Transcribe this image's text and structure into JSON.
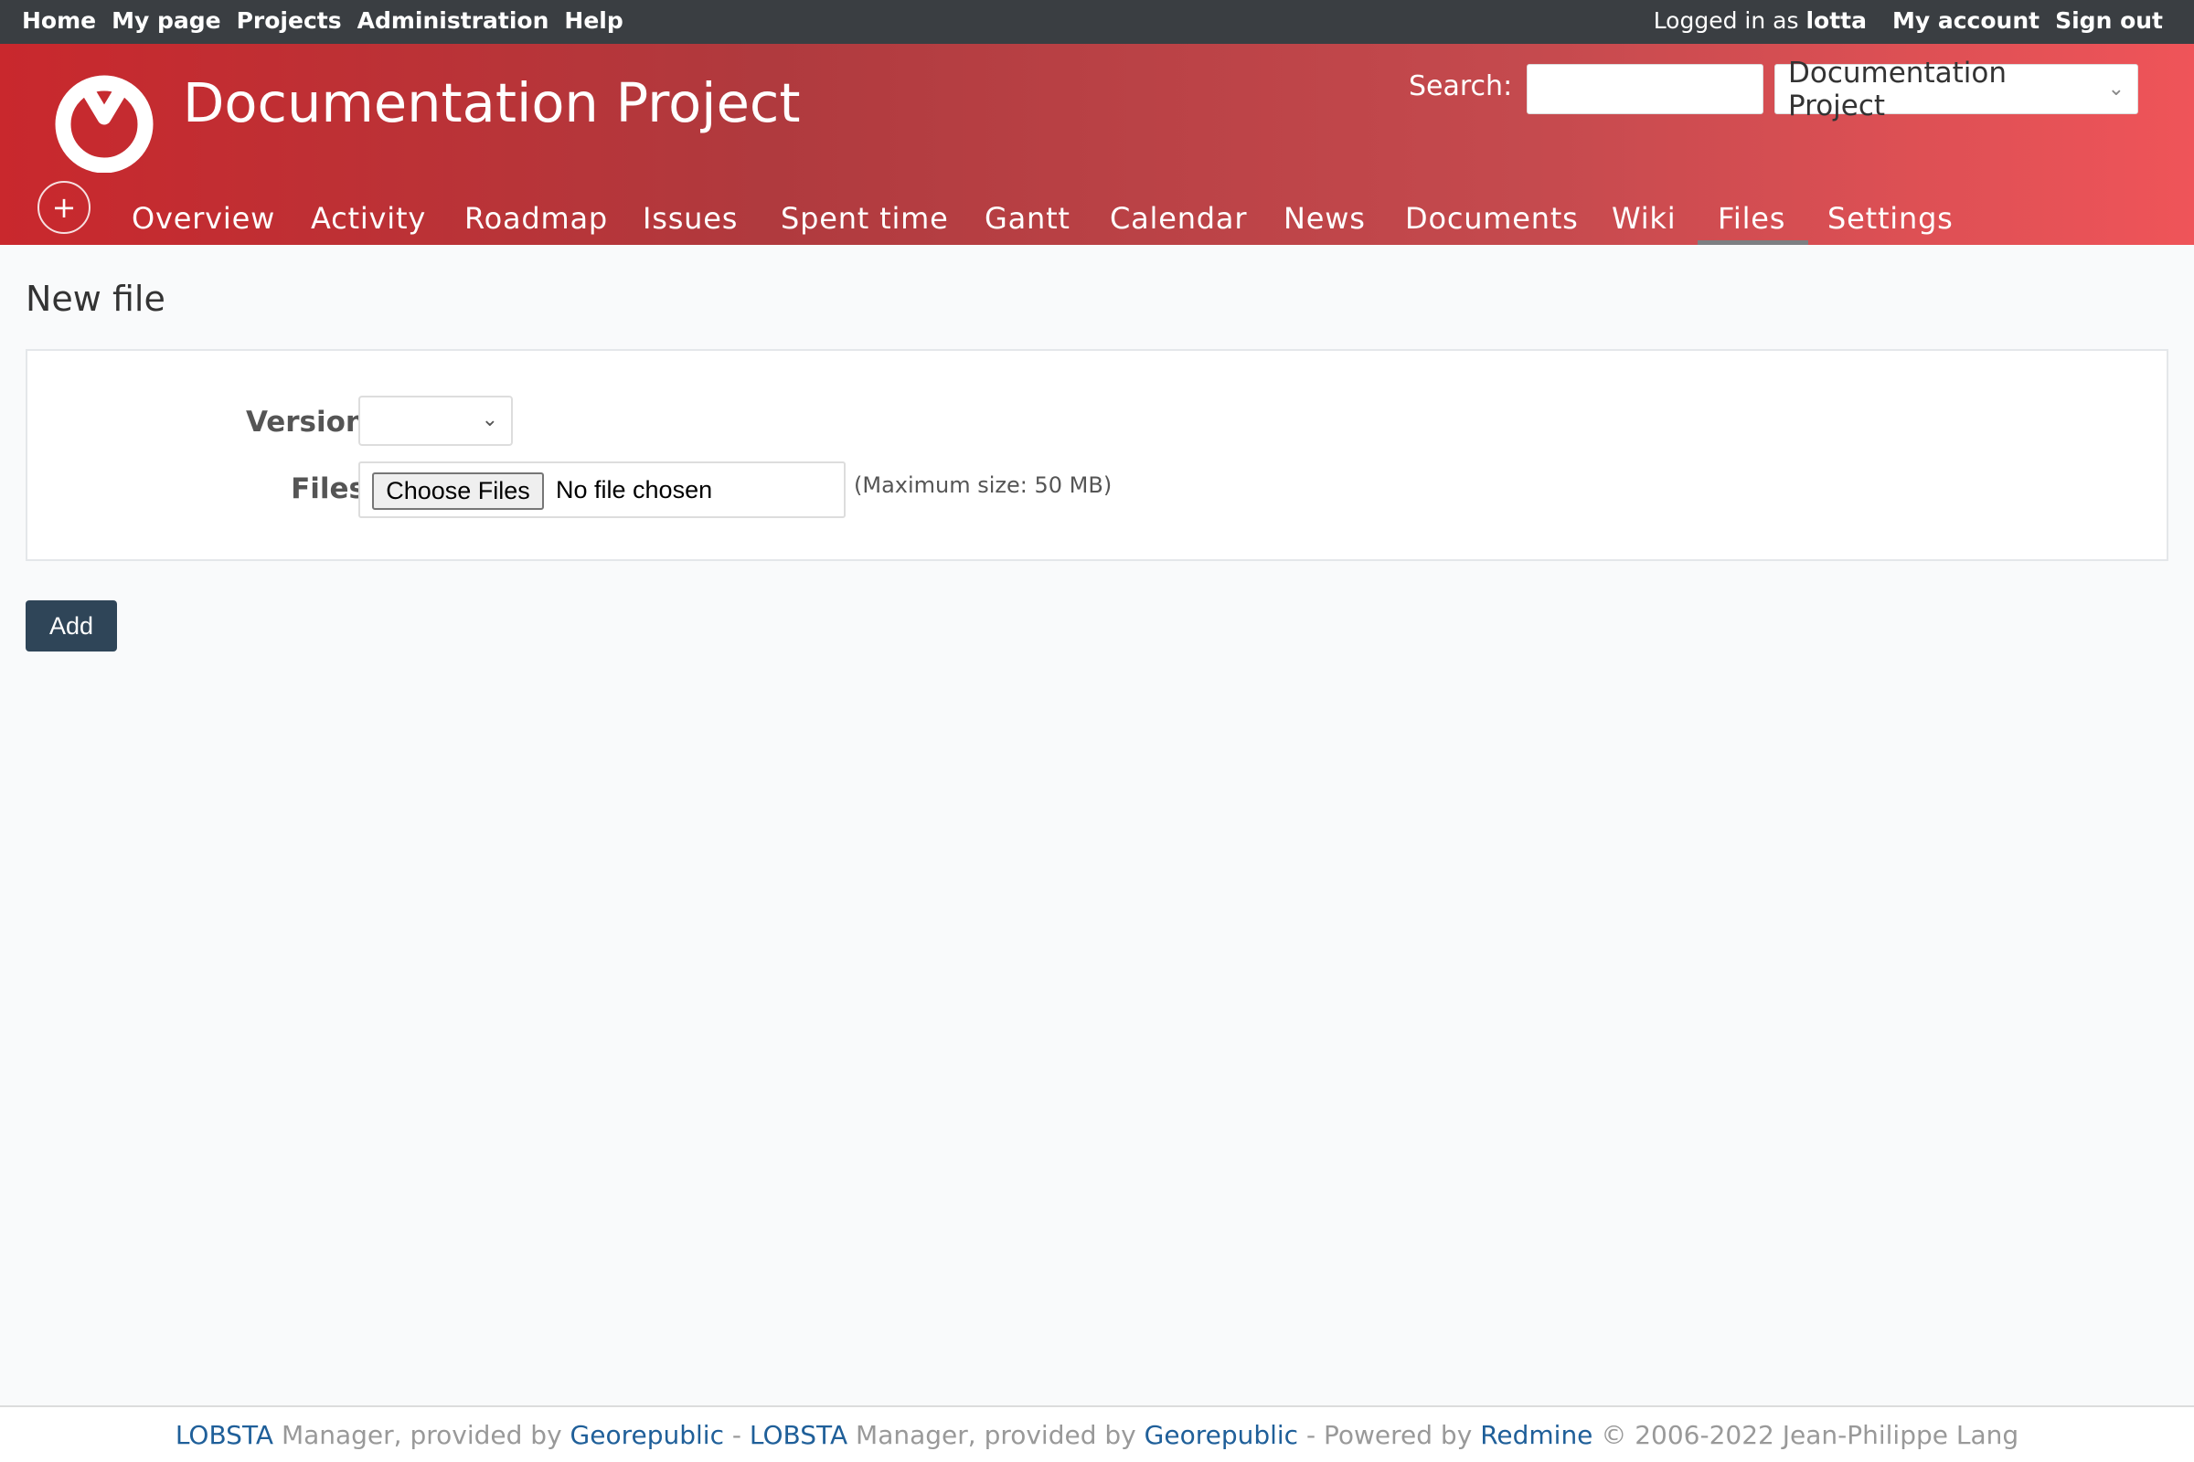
{
  "top_menu": {
    "items": [
      "Home",
      "My page",
      "Projects",
      "Administration",
      "Help"
    ],
    "logged_in_prefix": "Logged in as",
    "user": "lotta",
    "my_account": "My account",
    "sign_out": "Sign out"
  },
  "header": {
    "project_title": "Documentation Project",
    "search_label": "Search:",
    "search_value": "",
    "jump_selected": "Documentation Project",
    "new_object_icon": "+"
  },
  "main_menu": {
    "tabs": [
      "Overview",
      "Activity",
      "Roadmap",
      "Issues",
      "Spent time",
      "Gantt",
      "Calendar",
      "News",
      "Documents",
      "Wiki",
      "Files",
      "Settings"
    ],
    "selected": "Files"
  },
  "page": {
    "title": "New file",
    "version_label": "Version",
    "version_value": "",
    "files_label": "Files",
    "choose_files": "Choose Files",
    "no_file": "No file chosen",
    "max_size": "(Maximum size: 50 MB)",
    "add_button": "Add"
  },
  "footer": {
    "link1": "LOBSTA",
    "text1": "Manager, provided by",
    "link2": "Georepublic",
    "sep1": "-",
    "link3": "LOBSTA",
    "text2": "Manager, provided by",
    "link4": "Georepublic",
    "text3": "- Powered by",
    "link5": "Redmine",
    "text4": "© 2006-2022 Jean-Philippe Lang"
  },
  "colors": {
    "top_bar": "#3a3e42",
    "header_red": "#c9282d",
    "header_red_light": "#ef5459",
    "button": "#2f4558",
    "link": "#1f5f99"
  }
}
